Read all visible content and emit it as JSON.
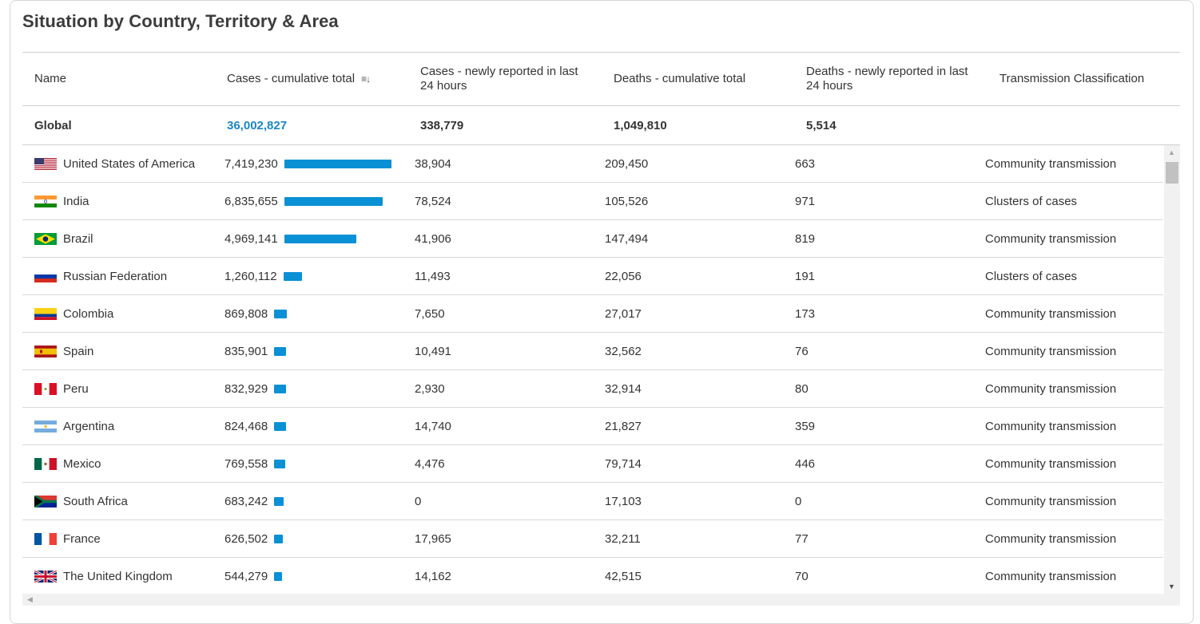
{
  "title": "Situation by Country, Territory & Area",
  "columns": {
    "name": "Name",
    "cases_total": "Cases - cumulative total",
    "cases_new": "Cases - newly reported in last 24 hours",
    "deaths_total": "Deaths - cumulative total",
    "deaths_new": "Deaths - newly reported in last 24 hours",
    "transmission": "Transmission Classification"
  },
  "global": {
    "name": "Global",
    "cases_total": "36,002,827",
    "cases_new": "338,779",
    "deaths_total": "1,049,810",
    "deaths_new": "5,514"
  },
  "colors": {
    "accent": "#0a90d4",
    "link": "#1a85c6"
  },
  "rows": [
    {
      "flag": "us-flag-icon",
      "name": "United States of America",
      "cases_total": "7,419,230",
      "bar_fraction": 1.0,
      "cases_new": "38,904",
      "deaths_total": "209,450",
      "deaths_new": "663",
      "transmission": "Community transmission"
    },
    {
      "flag": "in-flag-icon",
      "name": "India",
      "cases_total": "6,835,655",
      "bar_fraction": 0.921,
      "cases_new": "78,524",
      "deaths_total": "105,526",
      "deaths_new": "971",
      "transmission": "Clusters of cases"
    },
    {
      "flag": "br-flag-icon",
      "name": "Brazil",
      "cases_total": "4,969,141",
      "bar_fraction": 0.67,
      "cases_new": "41,906",
      "deaths_total": "147,494",
      "deaths_new": "819",
      "transmission": "Community transmission"
    },
    {
      "flag": "ru-flag-icon",
      "name": "Russian Federation",
      "cases_total": "1,260,112",
      "bar_fraction": 0.17,
      "cases_new": "11,493",
      "deaths_total": "22,056",
      "deaths_new": "191",
      "transmission": "Clusters of cases"
    },
    {
      "flag": "co-flag-icon",
      "name": "Colombia",
      "cases_total": "869,808",
      "bar_fraction": 0.117,
      "cases_new": "7,650",
      "deaths_total": "27,017",
      "deaths_new": "173",
      "transmission": "Community transmission"
    },
    {
      "flag": "es-flag-icon",
      "name": "Spain",
      "cases_total": "835,901",
      "bar_fraction": 0.113,
      "cases_new": "10,491",
      "deaths_total": "32,562",
      "deaths_new": "76",
      "transmission": "Community transmission"
    },
    {
      "flag": "pe-flag-icon",
      "name": "Peru",
      "cases_total": "832,929",
      "bar_fraction": 0.112,
      "cases_new": "2,930",
      "deaths_total": "32,914",
      "deaths_new": "80",
      "transmission": "Community transmission"
    },
    {
      "flag": "ar-flag-icon",
      "name": "Argentina",
      "cases_total": "824,468",
      "bar_fraction": 0.111,
      "cases_new": "14,740",
      "deaths_total": "21,827",
      "deaths_new": "359",
      "transmission": "Community transmission"
    },
    {
      "flag": "mx-flag-icon",
      "name": "Mexico",
      "cases_total": "769,558",
      "bar_fraction": 0.104,
      "cases_new": "4,476",
      "deaths_total": "79,714",
      "deaths_new": "446",
      "transmission": "Community transmission"
    },
    {
      "flag": "za-flag-icon",
      "name": "South Africa",
      "cases_total": "683,242",
      "bar_fraction": 0.092,
      "cases_new": "0",
      "deaths_total": "17,103",
      "deaths_new": "0",
      "transmission": "Community transmission"
    },
    {
      "flag": "fr-flag-icon",
      "name": "France",
      "cases_total": "626,502",
      "bar_fraction": 0.084,
      "cases_new": "17,965",
      "deaths_total": "32,211",
      "deaths_new": "77",
      "transmission": "Community transmission"
    },
    {
      "flag": "gb-flag-icon",
      "name": "The United Kingdom",
      "cases_total": "544,279",
      "bar_fraction": 0.073,
      "cases_new": "14,162",
      "deaths_total": "42,515",
      "deaths_new": "70",
      "transmission": "Community transmission"
    }
  ]
}
